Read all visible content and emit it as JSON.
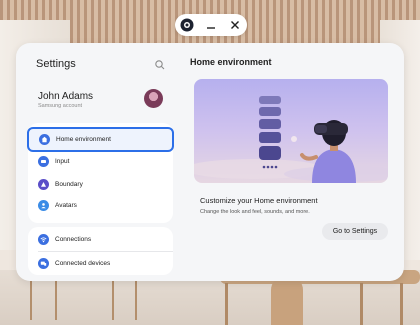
{
  "window": {
    "controls": [
      {
        "icon": "app-icon"
      },
      {
        "icon": "minimize-icon"
      },
      {
        "icon": "close-icon"
      }
    ]
  },
  "sidebar": {
    "title": "Settings",
    "search_icon": "search-icon",
    "account": {
      "name": "John Adams",
      "subtitle": "Samsung account"
    },
    "groups": [
      {
        "items": [
          {
            "label": "Home environment",
            "icon": "home-icon",
            "color": "#3b6fe0",
            "selected": true
          },
          {
            "label": "Input",
            "icon": "input-icon",
            "color": "#3b6fe0",
            "selected": false
          },
          {
            "label": "Boundary",
            "icon": "boundary-icon",
            "color": "#5b4ec8",
            "selected": false
          },
          {
            "label": "Avatars",
            "icon": "avatar-icon",
            "color": "#3b8ce6",
            "selected": false
          }
        ]
      },
      {
        "items": [
          {
            "label": "Connections",
            "icon": "wifi-icon",
            "color": "#3b6fe0",
            "selected": false
          },
          {
            "label": "Connected devices",
            "icon": "devices-icon",
            "color": "#3b6fe0",
            "selected": false
          }
        ]
      }
    ]
  },
  "content": {
    "title": "Home environment",
    "hero_caption": "Customize your Home environment",
    "hero_description": "Change the look and feel, sounds, and more.",
    "button_label": "Go to Settings"
  },
  "colors": {
    "accent": "#2c6fe8",
    "panel": "#f5f6f8",
    "hero_top": "#b6b0ee",
    "hero_bottom": "#e6d7e2"
  }
}
